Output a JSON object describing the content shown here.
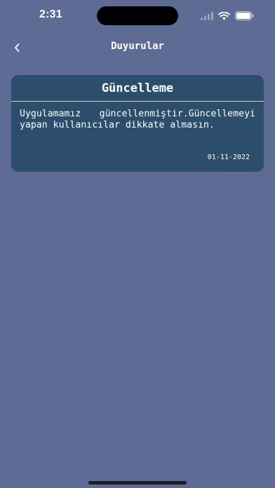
{
  "status_bar": {
    "time": "2:31",
    "icons": [
      "cellular-signal-icon",
      "wifi-icon",
      "battery-icon"
    ]
  },
  "nav": {
    "back_icon": "chevron-left-icon",
    "title": "Duyurular"
  },
  "announcements": [
    {
      "title": "Güncelleme",
      "body": "Uygulamamız güncellenmiştir.Güncellemeyi yapan kullanıcılar dikkate almasın.",
      "date": "01-11-2022"
    }
  ],
  "colors": {
    "background": "#5e6c95",
    "card": "#2c4d6c",
    "text": "#ffffff"
  }
}
